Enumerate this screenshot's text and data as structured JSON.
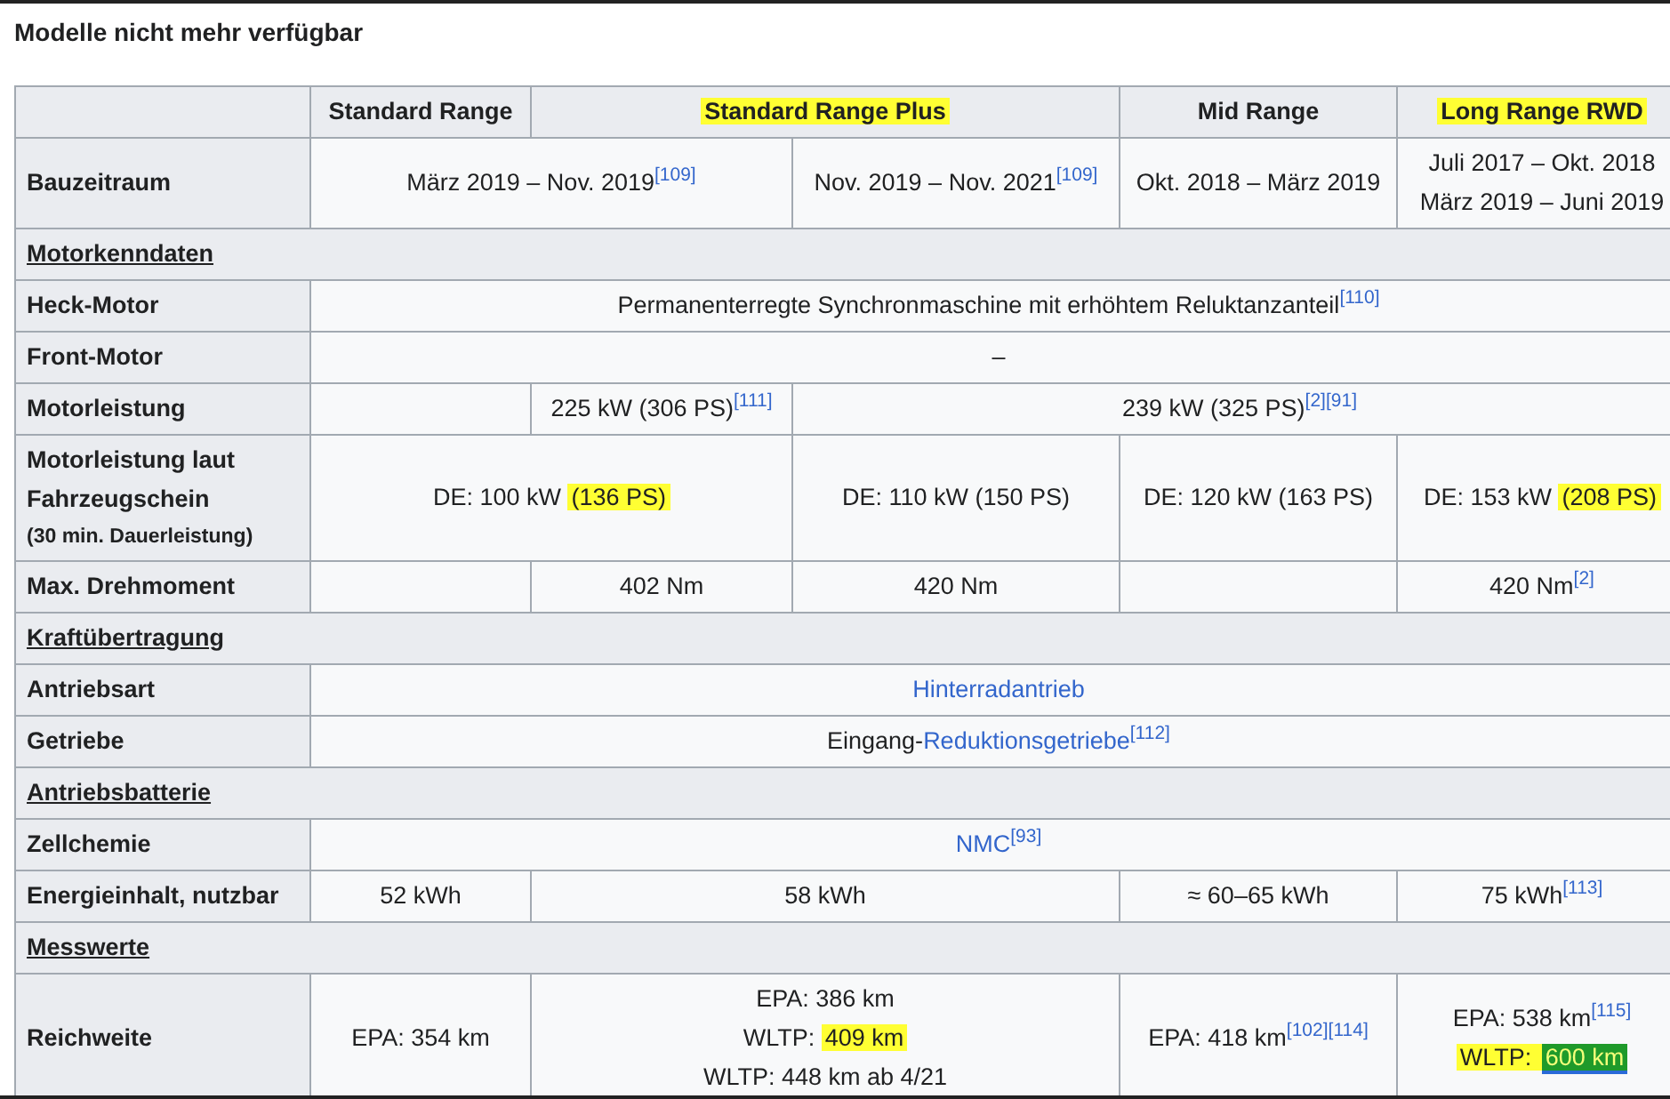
{
  "title": "Modelle nicht mehr verfügbar",
  "table": {
    "header": [
      {
        "kind": "single"
      },
      {
        "kind": "single",
        "lines": [
          [
            {
              "kind": "text",
              "text": "Standard Range"
            }
          ]
        ]
      },
      {
        "kind": "double",
        "lines": [
          [
            {
              "kind": "mark",
              "text": "Standard Range Plus",
              "color": "#ffff33"
            }
          ]
        ]
      },
      {
        "kind": "single",
        "lines": [
          [
            {
              "kind": "text",
              "text": "Mid Range"
            }
          ]
        ]
      },
      {
        "kind": "single",
        "lines": [
          [
            {
              "kind": "mark",
              "text": "Long Range RWD",
              "color": "#ffff33"
            }
          ]
        ]
      }
    ],
    "rows": [
      {
        "kind": "data",
        "label": "Bauzeitraum",
        "cells": [
          {
            "kind": "double",
            "lines": [
              [
                {
                  "kind": "text",
                  "text": "März 2019 – Nov. 2019"
                },
                {
                  "kind": "ref",
                  "text": "[109]"
                }
              ]
            ]
          },
          {
            "kind": "single",
            "lines": [
              [
                {
                  "kind": "text",
                  "text": "Nov. 2019 – Nov. 2021"
                },
                {
                  "kind": "ref",
                  "text": "[109]"
                }
              ]
            ]
          },
          {
            "kind": "single",
            "lines": [
              [
                {
                  "kind": "text",
                  "text": "Okt. 2018 – März 2019"
                }
              ]
            ]
          },
          {
            "kind": "single",
            "lines": [
              [
                {
                  "kind": "text",
                  "text": "Juli 2017 – Okt. 2018"
                }
              ],
              [
                {
                  "kind": "text",
                  "text": "März 2019 – Juni 2019"
                }
              ]
            ]
          }
        ]
      },
      {
        "kind": "section",
        "label": "Motorkenndaten"
      },
      {
        "kind": "data",
        "label": "Heck-Motor",
        "cells": [
          {
            "kind": "full",
            "lines": [
              [
                {
                  "kind": "text",
                  "text": "Permanenterregte Synchronmaschine mit erhöhtem Reluktanzanteil"
                },
                {
                  "kind": "ref",
                  "text": "[110]"
                }
              ]
            ]
          }
        ]
      },
      {
        "kind": "data",
        "label": "Front-Motor",
        "cells": [
          {
            "kind": "full",
            "lines": [
              [
                {
                  "kind": "text",
                  "text": "–"
                }
              ]
            ]
          }
        ]
      },
      {
        "kind": "data",
        "label": "Motorleistung",
        "cells": [
          {
            "kind": "single"
          },
          {
            "kind": "single",
            "lines": [
              [
                {
                  "kind": "text",
                  "text": "225 kW (306 PS)"
                },
                {
                  "kind": "ref",
                  "text": "[111]"
                }
              ]
            ]
          },
          {
            "kind": "triple",
            "lines": [
              [
                {
                  "kind": "text",
                  "text": "239 kW (325 PS)"
                },
                {
                  "kind": "ref",
                  "text": "[2]"
                },
                {
                  "kind": "ref",
                  "text": "[91]"
                }
              ]
            ]
          }
        ]
      },
      {
        "kind": "data",
        "label": "Motorleistung laut Fahrzeugschein",
        "note": "(30 min. Dauerleistung)",
        "cells": [
          {
            "kind": "double",
            "lines": [
              [
                {
                  "kind": "text",
                  "text": "DE: 100 kW "
                },
                {
                  "kind": "mark",
                  "text": "(136 PS)",
                  "color": "#ffff33"
                }
              ]
            ]
          },
          {
            "kind": "single",
            "lines": [
              [
                {
                  "kind": "text",
                  "text": "DE: 110 kW (150 PS)"
                }
              ]
            ]
          },
          {
            "kind": "single",
            "lines": [
              [
                {
                  "kind": "text",
                  "text": "DE: 120 kW (163 PS)"
                }
              ]
            ]
          },
          {
            "kind": "single",
            "lines": [
              [
                {
                  "kind": "text",
                  "text": "DE: 153 kW "
                },
                {
                  "kind": "mark",
                  "text": "(208 PS)",
                  "color": "#ffff33"
                }
              ]
            ]
          }
        ]
      },
      {
        "kind": "data",
        "label": "Max. Drehmoment",
        "cells": [
          {
            "kind": "single"
          },
          {
            "kind": "single",
            "lines": [
              [
                {
                  "kind": "text",
                  "text": "402 Nm"
                }
              ]
            ]
          },
          {
            "kind": "single",
            "lines": [
              [
                {
                  "kind": "text",
                  "text": "420 Nm"
                }
              ]
            ]
          },
          {
            "kind": "single"
          },
          {
            "kind": "single",
            "lines": [
              [
                {
                  "kind": "text",
                  "text": "420 Nm"
                },
                {
                  "kind": "ref",
                  "text": "[2]"
                }
              ]
            ]
          }
        ]
      },
      {
        "kind": "section",
        "label": "Kraftübertragung"
      },
      {
        "kind": "data",
        "label": "Antriebsart",
        "cells": [
          {
            "kind": "full",
            "lines": [
              [
                {
                  "kind": "link",
                  "text": "Hinterradantrieb"
                }
              ]
            ]
          }
        ]
      },
      {
        "kind": "data",
        "label": "Getriebe",
        "cells": [
          {
            "kind": "full",
            "lines": [
              [
                {
                  "kind": "text",
                  "text": "Eingang-"
                },
                {
                  "kind": "link",
                  "text": "Reduktionsgetriebe"
                },
                {
                  "kind": "ref",
                  "text": "[112]"
                }
              ]
            ]
          }
        ]
      },
      {
        "kind": "section",
        "label": "Antriebsbatterie"
      },
      {
        "kind": "data",
        "label": "Zellchemie",
        "cells": [
          {
            "kind": "full",
            "lines": [
              [
                {
                  "kind": "link",
                  "text": "NMC"
                },
                {
                  "kind": "ref",
                  "text": "[93]"
                }
              ]
            ]
          }
        ]
      },
      {
        "kind": "data",
        "label": "Energieinhalt, nutzbar",
        "cells": [
          {
            "kind": "single",
            "lines": [
              [
                {
                  "kind": "text",
                  "text": "52 kWh"
                }
              ]
            ]
          },
          {
            "kind": "double",
            "lines": [
              [
                {
                  "kind": "text",
                  "text": "58 kWh"
                }
              ]
            ]
          },
          {
            "kind": "single",
            "lines": [
              [
                {
                  "kind": "text",
                  "text": "≈ 60–65 kWh"
                }
              ]
            ]
          },
          {
            "kind": "single",
            "lines": [
              [
                {
                  "kind": "text",
                  "text": "75 kWh"
                },
                {
                  "kind": "ref",
                  "text": "[113]"
                }
              ]
            ]
          }
        ]
      },
      {
        "kind": "section",
        "label": "Messwerte"
      },
      {
        "kind": "data",
        "label": "Reichweite",
        "cells": [
          {
            "kind": "single",
            "lines": [
              [
                {
                  "kind": "text",
                  "text": "EPA: 354 km"
                }
              ]
            ]
          },
          {
            "kind": "double",
            "lines": [
              [
                {
                  "kind": "text",
                  "text": "EPA: 386 km"
                }
              ],
              [
                {
                  "kind": "text",
                  "text": "WLTP: "
                },
                {
                  "kind": "mark",
                  "text": "409 km",
                  "color": "#ffff33"
                }
              ],
              [
                {
                  "kind": "text",
                  "text": "WLTP: 448 km ab 4/21"
                }
              ]
            ]
          },
          {
            "kind": "single",
            "lines": [
              [
                {
                  "kind": "text",
                  "text": "EPA: 418 km"
                },
                {
                  "kind": "ref",
                  "text": "[102]"
                },
                {
                  "kind": "ref",
                  "text": "[114]"
                }
              ]
            ]
          },
          {
            "kind": "single",
            "lines": [
              [
                {
                  "kind": "text",
                  "text": "EPA: 538 km"
                },
                {
                  "kind": "ref",
                  "text": "[115]"
                }
              ],
              [
                {
                  "kind": "mark",
                  "text": "WLTP: ",
                  "color": "#ffff33"
                },
                {
                  "kind": "mark",
                  "text": "600 km",
                  "color": "#1f9a2a"
                }
              ]
            ]
          }
        ]
      }
    ]
  }
}
